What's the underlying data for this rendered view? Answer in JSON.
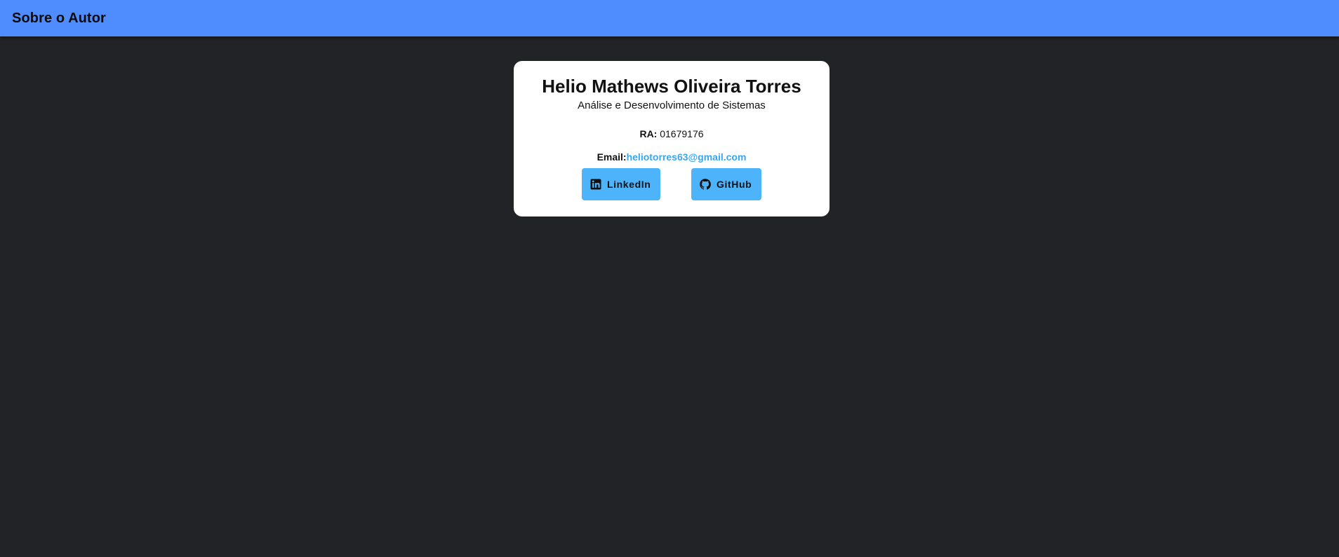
{
  "appbar": {
    "title": "Sobre o Autor",
    "color": "#4f8dff"
  },
  "author": {
    "name": "Helio Mathews Oliveira Torres",
    "course": "Análise e Desenvolvimento de Sistemas",
    "ra_label": "RA:",
    "ra_value": "01679176",
    "email_label": "Email:",
    "email_value": "heliotorres63@gmail.com"
  },
  "buttons": {
    "linkedin": {
      "label": "LinkedIn",
      "icon": "linkedin-icon"
    },
    "github": {
      "label": "GitHub",
      "icon": "github-icon"
    },
    "color": "#4db3fb"
  },
  "colors": {
    "background": "#222327",
    "card": "#ffffff",
    "link": "#3aa6ef"
  }
}
